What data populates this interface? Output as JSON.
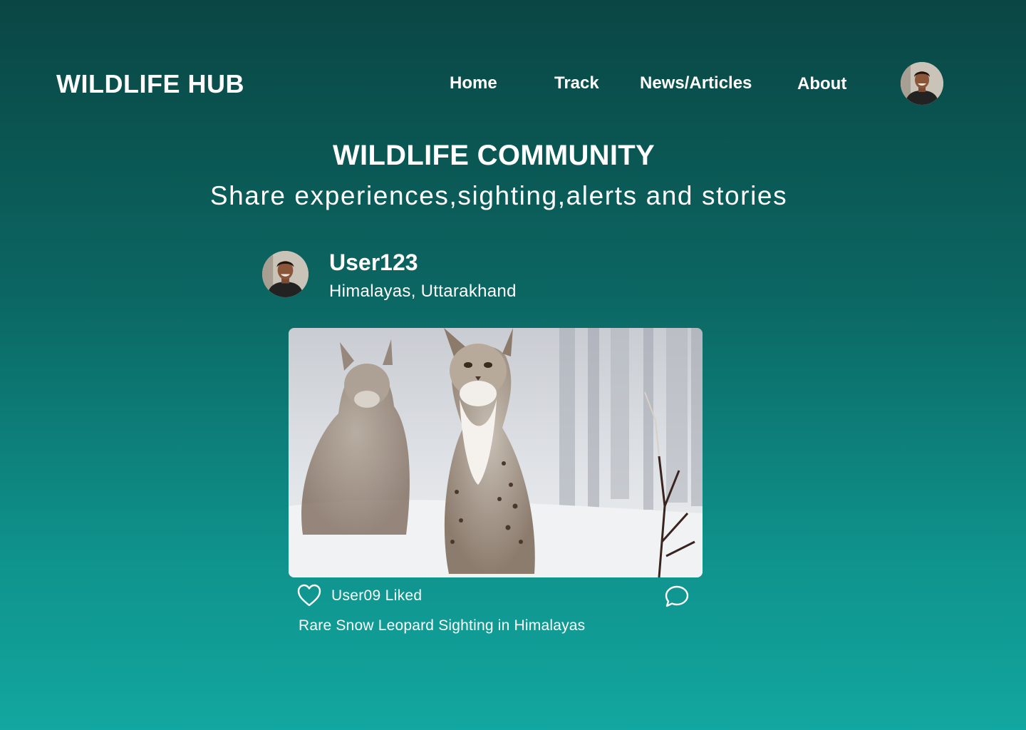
{
  "header": {
    "logo": "WILDLIFE HUB",
    "nav": {
      "home": "Home",
      "track": "Track",
      "news": "News/Articles",
      "about": "About"
    }
  },
  "page": {
    "title": "WILDLIFE COMMUNITY",
    "subtitle": "Share experiences,sighting,alerts and stories"
  },
  "post": {
    "username": "User123",
    "location": "Himalayas, Uttarakhand",
    "liked_text": "User09 Liked",
    "caption": "Rare Snow Leopard Sighting in Himalayas"
  },
  "colors": {
    "gradient_top": "#0a4644",
    "gradient_bottom": "#12a7a0",
    "text": "#ffffff"
  },
  "icons": {
    "like": "heart-icon",
    "comment": "comment-icon"
  }
}
